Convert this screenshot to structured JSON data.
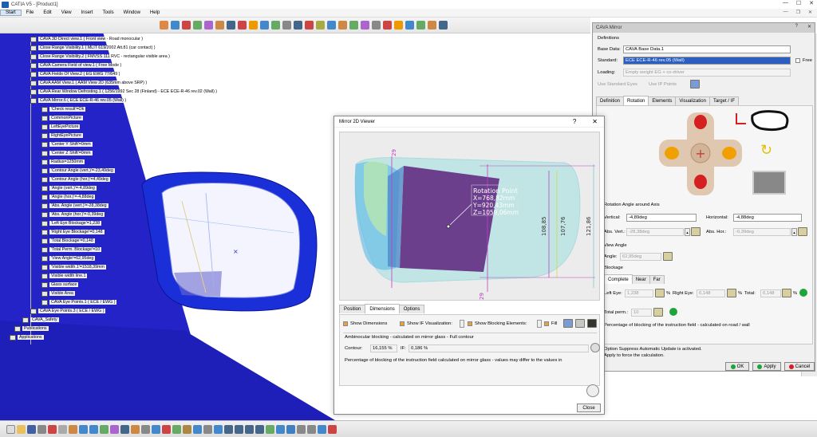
{
  "app": {
    "title": "CATIA V5 - [Product1]",
    "menu": [
      "Start",
      "File",
      "Edit",
      "View",
      "Insert",
      "Tools",
      "Window",
      "Help"
    ]
  },
  "tree": {
    "items": [
      "CAVA 3D Direct view.1 ( Front view - Road monocular )",
      "Close Range Visibility.1 ( MLIT 619/2002 Att.81 (car contact) )",
      "Close Range Visibility.2 ( FMVSS 111 RVC - rectangular visible area )",
      "CAVA Camera Field of view.1 ( Free Mode )",
      "CAVA Fields Of View.2 ( EG EWG 77/649 )",
      "CAVA AAM View.1 ( AAM View 2D (635mm above SRP) )",
      "CAVA Rear Window Defrosting.1 ( 1256/1992 Sec 28 (Finland) - ECE ECE-R-46 rev.02 (Wall) )",
      "CAVA Mirror.6 ( ECE ECE-R-46 rev.05 (Wall) )",
      "'Check result'=Ok",
      "CommonPicture",
      "LeftEyePicture",
      "RightEyePicture",
      "'Center Y Shift'=0mm",
      "'Center Z Shift'=0mm",
      "Radius=1250mm",
      "'Contour Angle (vert.)'=-23,49deg",
      "'Contour Angle (hor.)'=4,49deg",
      "'Angle (vert.)'=-4,89deg",
      "'Angle (hor.)'=-4,88deg",
      "'Abs. Angle (vert.)'=-28,38deg",
      "'Abs. Angle (hor.)'=-0,39deg",
      "'Left Eye Blockage'=1,238",
      "'Right Eye Blockage'=0,148",
      "'Total Blockage'=0,148",
      "'Total Perm. Blockage'=10",
      "'View Angle'=62,95deg",
      "'Visible width.1'=1518,39mm",
      "Visible width line.1",
      "Glass surface",
      "Visible Area",
      "CAVA Eye Points.1 ( ECE / EWG )",
      "CAVA Eye Points.3 ( ECE / EWG )",
      "CAVA_Safety",
      "Publications",
      "Applications"
    ]
  },
  "cava_panel": {
    "title": "CAVA Mirror",
    "definitions_label": "Definitions",
    "base_data_label": "Base Data:",
    "base_data_value": "CAVA Base Data.1",
    "standard_label": "Standard:",
    "standard_value": "ECE ECE-R-46 rev.05 (Wall)",
    "free_label": "Free",
    "loading_label": "Loading:",
    "loading_value": "Empty weight EG + co-driver",
    "use_std_eyes": "Use Standard Eyes",
    "use_ip_points": "Use IP Points",
    "tabs": [
      "Definition",
      "Rotation",
      "Elements",
      "Visualization",
      "Target / IF"
    ],
    "rot_angle_label": "Rotation Angle around Axis",
    "vertical_label": "Vertical:",
    "vertical_value": "-4,89deg",
    "horizontal_label": "Horizontal:",
    "horizontal_value": "-4,88deg",
    "abs_vert_label": "Abs. Vert.:",
    "abs_vert_value": "-28,38deg",
    "abs_hor_label": "Abs. Hor.:",
    "abs_hor_value": "-0,39deg",
    "view_angle_label": "View Angle",
    "angle_label": "Angle:",
    "angle_value": "62,95deg",
    "blockage_label": "Blockage",
    "block_tabs": [
      "Complete",
      "Near",
      "Far"
    ],
    "left_eye_label": "Left Eye:",
    "left_eye_value": "1,238",
    "right_eye_label": "Right Eye:",
    "right_eye_value": "0,148",
    "total_label": "Total:",
    "total_value": "0,148",
    "pct": "%",
    "total_perm_label": "Total perm.:",
    "total_perm_value": "10",
    "blockage_note": "Percentage of blocking of the instruction field - calculated on road / wall",
    "suppress_note": "Option Suppress Automatic Update is activated.",
    "apply_note": "Apply to force the calculation.",
    "ok": "OK",
    "apply": "Apply",
    "cancel": "Cancel"
  },
  "viewer": {
    "title": "Mirror 2D Viewer",
    "help": "?",
    "close_x": "✕",
    "rotation_point": "Rotation Point",
    "rp_x": "X=768,82mm",
    "rp_y": "Y=920,43mm",
    "rp_z": "Z=1059,06mm",
    "dim_1": "108,85",
    "dim_2": "107,76",
    "dim_3": "121,86",
    "dim_top": "29",
    "dim_bot": "29",
    "tabs": [
      "Position",
      "Dimensions",
      "Options"
    ],
    "show_dimensions": "Show Dimensions",
    "show_if": "Show IF Visualization:",
    "show_blocking": "Show Blocking Elements:",
    "fill": "Fill",
    "ambinocular": "Ambinocular blocking - calculated on mirror glass - Full contour",
    "contour_label": "Contour:",
    "contour_value": "16,155 %",
    "if_label": "IF:",
    "if_value": "0,186 %",
    "note": "Percentage of blocking of the instruction field calculated on mirror glass - values may differ to the values in",
    "close_btn": "Close"
  },
  "colors": {
    "catia_blue": "#2323c8",
    "mirror_purple": "#6b3f8c",
    "mirror_cyan": "#9fe0e0",
    "dim_magenta": "#c040c0",
    "dim_yellow": "#d9d93a",
    "ok_green": "#1fa43a",
    "arrow_red": "#d42020",
    "arrow_orange": "#f0a000",
    "selection_blue": "#2a5ec0"
  }
}
